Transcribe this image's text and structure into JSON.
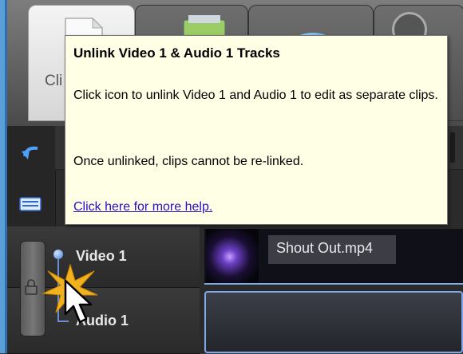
{
  "tabs": {
    "clips_label": "Cli"
  },
  "tooltip": {
    "title": "Unlink Video 1 & Audio 1 Tracks",
    "body": "Click icon to unlink Video 1 and Audio 1 to edit as separate clips.",
    "note": "Once unlinked, clips cannot be re-linked.",
    "help_link": "Click here for more help."
  },
  "tracks": [
    {
      "name": "Video 1"
    },
    {
      "name": "Audio 1"
    }
  ],
  "clip": {
    "title": "Shout Out.mp4"
  },
  "icons": {
    "toolbar": [
      "undo-icon",
      "keyboard-icon"
    ],
    "track": [
      "lock-icon",
      "link-dot-icon"
    ],
    "cursor": "pointer-cursor-icon"
  },
  "colors": {
    "tooltip_bg": "#ffffe6",
    "link": "#2a10c8",
    "selection": "#7fa9e8"
  }
}
